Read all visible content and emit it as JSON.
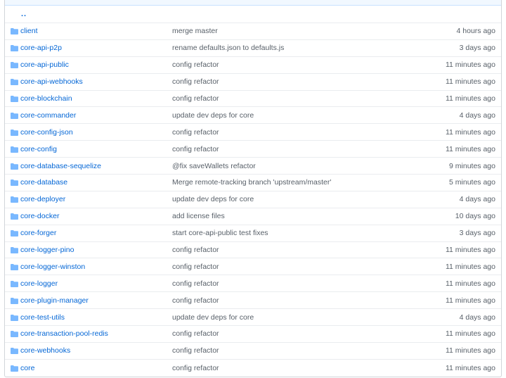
{
  "parent_link": "..",
  "folder_icon": "folder-icon",
  "colors": {
    "link": "#0366d6",
    "muted": "#586069",
    "folder": "#79b8ff",
    "border": "#eaecef"
  },
  "rows": [
    {
      "name": "client",
      "message": "merge master",
      "age": "4 hours ago"
    },
    {
      "name": "core-api-p2p",
      "message": "rename defaults.json to defaults.js",
      "age": "3 days ago"
    },
    {
      "name": "core-api-public",
      "message": "config refactor",
      "age": "11 minutes ago"
    },
    {
      "name": "core-api-webhooks",
      "message": "config refactor",
      "age": "11 minutes ago"
    },
    {
      "name": "core-blockchain",
      "message": "config refactor",
      "age": "11 minutes ago"
    },
    {
      "name": "core-commander",
      "message": "update dev deps for core",
      "age": "4 days ago"
    },
    {
      "name": "core-config-json",
      "message": "config refactor",
      "age": "11 minutes ago"
    },
    {
      "name": "core-config",
      "message": "config refactor",
      "age": "11 minutes ago"
    },
    {
      "name": "core-database-sequelize",
      "message": "@fix saveWallets refactor",
      "age": "9 minutes ago"
    },
    {
      "name": "core-database",
      "message": "Merge remote-tracking branch 'upstream/master'",
      "age": "5 minutes ago"
    },
    {
      "name": "core-deployer",
      "message": "update dev deps for core",
      "age": "4 days ago"
    },
    {
      "name": "core-docker",
      "message": "add license files",
      "age": "10 days ago"
    },
    {
      "name": "core-forger",
      "message": "start core-api-public test fixes",
      "age": "3 days ago"
    },
    {
      "name": "core-logger-pino",
      "message": "config refactor",
      "age": "11 minutes ago"
    },
    {
      "name": "core-logger-winston",
      "message": "config refactor",
      "age": "11 minutes ago"
    },
    {
      "name": "core-logger",
      "message": "config refactor",
      "age": "11 minutes ago"
    },
    {
      "name": "core-plugin-manager",
      "message": "config refactor",
      "age": "11 minutes ago"
    },
    {
      "name": "core-test-utils",
      "message": "update dev deps for core",
      "age": "4 days ago"
    },
    {
      "name": "core-transaction-pool-redis",
      "message": "config refactor",
      "age": "11 minutes ago"
    },
    {
      "name": "core-webhooks",
      "message": "config refactor",
      "age": "11 minutes ago"
    },
    {
      "name": "core",
      "message": "config refactor",
      "age": "11 minutes ago"
    }
  ]
}
